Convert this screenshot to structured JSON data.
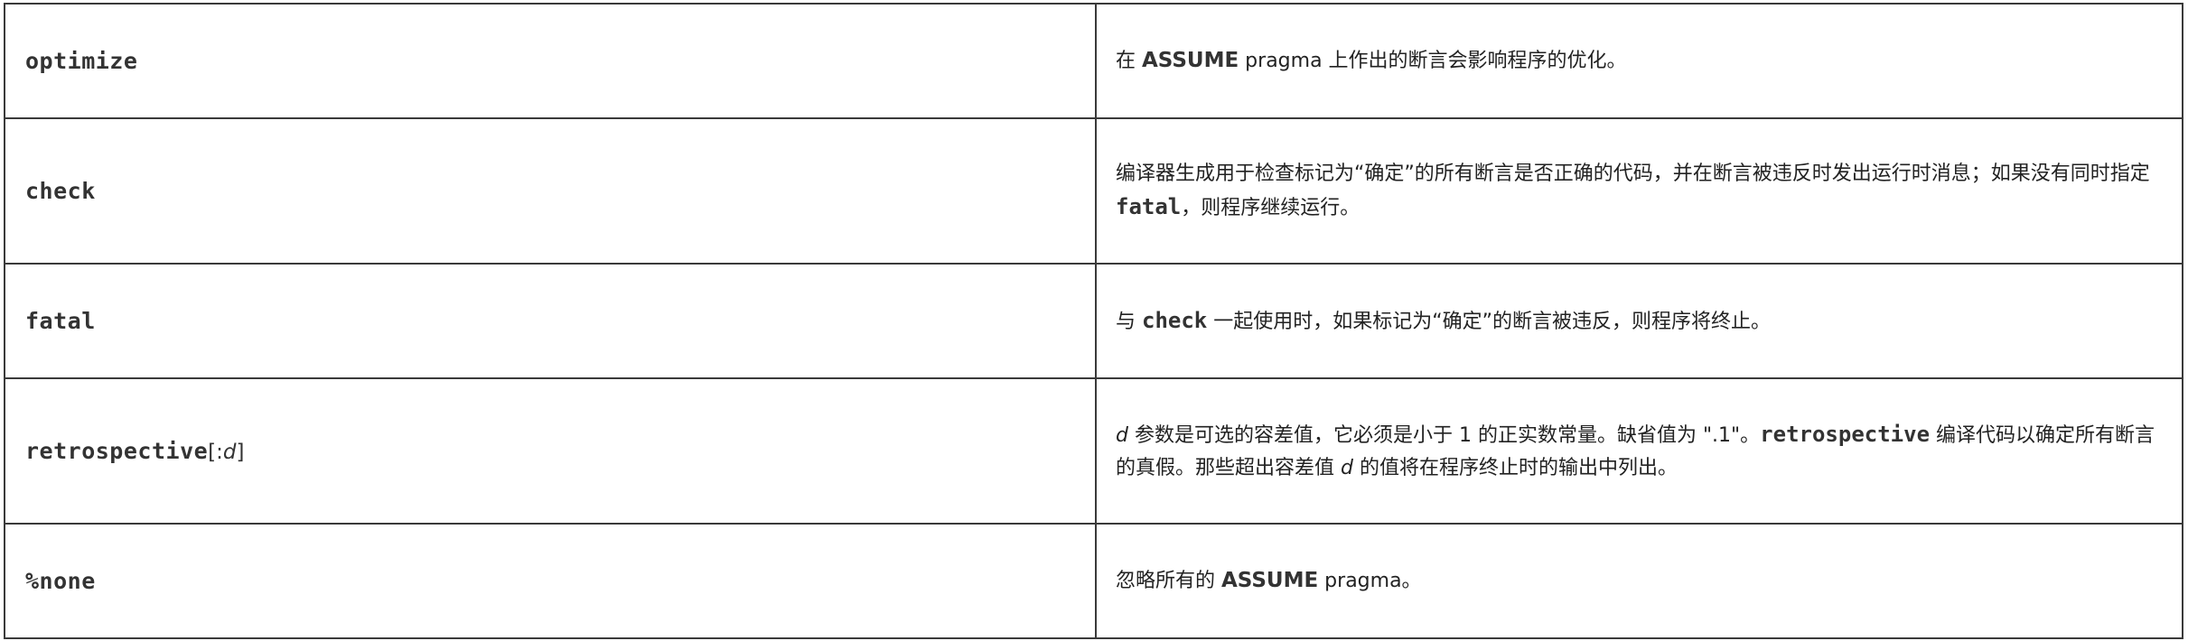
{
  "rows": [
    {
      "option": "optimize",
      "desc": {
        "t1": "在 ",
        "kw1": "ASSUME",
        "t2": " pragma 上作出的断言会影响程序的优化。"
      }
    },
    {
      "option": "check",
      "desc": {
        "t1": "编译器生成用于检查标记为“确定”的所有断言是否正确的代码，并在断言被违反时发出运行时消息；如果没有同时指定 ",
        "code1": "fatal",
        "t2": "，则程序继续运行。"
      }
    },
    {
      "option": "fatal",
      "desc": {
        "t1": "与 ",
        "code1": "check",
        "t2": " 一起使用时，如果标记为“确定”的断言被违反，则程序将终止。"
      }
    },
    {
      "option": "retrospective",
      "option_suffix_open": "[:",
      "option_param": "d",
      "option_suffix_close": "]",
      "desc": {
        "v1": "d",
        "t1": " 参数是可选的容差值，它必须是小于 1 的正实数常量。缺省值为 \".1\"。",
        "code1": "retrospective",
        "t2": " 编译代码以确定所有断言的真假。那些超出容差值 ",
        "v2": "d",
        "t3": " 的值将在程序终止时的输出中列出。"
      }
    },
    {
      "option": "%none",
      "desc": {
        "t1": "忽略所有的 ",
        "kw1": "ASSUME",
        "t2": " pragma。"
      }
    }
  ]
}
